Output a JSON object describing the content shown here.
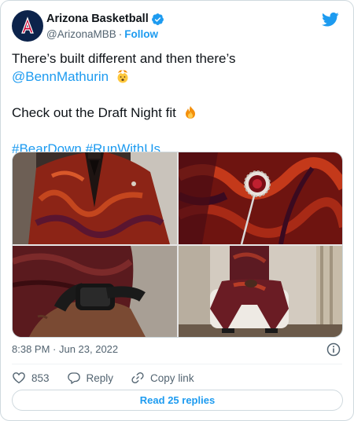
{
  "account": {
    "display_name": "Arizona Basketball",
    "handle": "@ArizonaMBB",
    "separator": "·",
    "follow_label": "Follow",
    "avatar_letter": "A",
    "brand_color": "#0c234b",
    "accent_color": "#cc0033"
  },
  "tweet": {
    "line1": "There’s built different and then there’s",
    "mention": "@BennMathurin",
    "line3": "Check out the Draft Night fit",
    "hashtag1": "#BearDown",
    "hashtag2": "#RunWithUs",
    "emoji_after_mention": "exploding-head-emoji",
    "emoji_after_fit": "fire-emoji"
  },
  "media": {
    "photos": [
      {
        "name": "photo-jacket-front",
        "icon": "red-paisley-suit-jacket"
      },
      {
        "name": "photo-lapel-pin",
        "icon": "brooch-on-lapel"
      },
      {
        "name": "photo-wrist-watch",
        "icon": "black-wristwatch"
      },
      {
        "name": "photo-seated",
        "icon": "seated-full-suit"
      }
    ]
  },
  "meta": {
    "timestamp": "8:38 PM · Jun 23, 2022"
  },
  "actions": {
    "like_count": "853",
    "reply_label": "Reply",
    "copy_link_label": "Copy link"
  },
  "read_replies_label": "Read 25 replies",
  "colors": {
    "link": "#1d9bf0",
    "secondary_text": "#536471",
    "border": "#cfd9de"
  }
}
